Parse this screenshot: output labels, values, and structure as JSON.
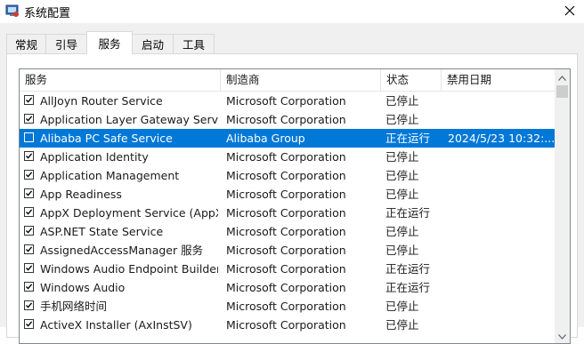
{
  "window": {
    "title": "系统配置",
    "app_icon": "msconfig-icon",
    "close_icon": "close-icon"
  },
  "tabs": [
    {
      "label": "常规",
      "active": false
    },
    {
      "label": "引导",
      "active": false
    },
    {
      "label": "服务",
      "active": true
    },
    {
      "label": "启动",
      "active": false
    },
    {
      "label": "工具",
      "active": false
    }
  ],
  "table": {
    "columns": [
      "服务",
      "制造商",
      "状态",
      "禁用日期"
    ],
    "rows": [
      {
        "checked": true,
        "name": "AllJoyn Router Service",
        "maker": "Microsoft Corporation",
        "status": "已停止",
        "disabled": ""
      },
      {
        "checked": true,
        "name": "Application Layer Gateway Service",
        "maker": "Microsoft Corporation",
        "status": "已停止",
        "disabled": ""
      },
      {
        "checked": false,
        "name": "Alibaba PC Safe Service",
        "maker": "Alibaba Group",
        "status": "正在运行",
        "disabled": "2024/5/23 10:32:...",
        "selected": true
      },
      {
        "checked": true,
        "name": "Application Identity",
        "maker": "Microsoft Corporation",
        "status": "已停止",
        "disabled": ""
      },
      {
        "checked": true,
        "name": "Application Management",
        "maker": "Microsoft Corporation",
        "status": "已停止",
        "disabled": ""
      },
      {
        "checked": true,
        "name": "App Readiness",
        "maker": "Microsoft Corporation",
        "status": "已停止",
        "disabled": ""
      },
      {
        "checked": true,
        "name": "AppX Deployment Service (AppX...",
        "maker": "Microsoft Corporation",
        "status": "正在运行",
        "disabled": ""
      },
      {
        "checked": true,
        "name": "ASP.NET State Service",
        "maker": "Microsoft Corporation",
        "status": "已停止",
        "disabled": ""
      },
      {
        "checked": true,
        "name": "AssignedAccessManager 服务",
        "maker": "Microsoft Corporation",
        "status": "已停止",
        "disabled": ""
      },
      {
        "checked": true,
        "name": "Windows Audio Endpoint Builder",
        "maker": "Microsoft Corporation",
        "status": "正在运行",
        "disabled": ""
      },
      {
        "checked": true,
        "name": "Windows Audio",
        "maker": "Microsoft Corporation",
        "status": "正在运行",
        "disabled": ""
      },
      {
        "checked": true,
        "name": "手机网络时间",
        "maker": "Microsoft Corporation",
        "status": "已停止",
        "disabled": ""
      },
      {
        "checked": true,
        "name": "ActiveX Installer (AxInstSV)",
        "maker": "Microsoft Corporation",
        "status": "已停止",
        "disabled": ""
      }
    ]
  },
  "colors": {
    "selection": "#0078d7",
    "panel_bg": "#f0f0f0"
  }
}
